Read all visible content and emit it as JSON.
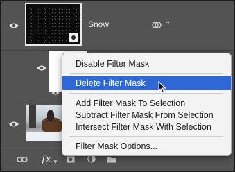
{
  "layers": {
    "snow": {
      "name": "Snow"
    }
  },
  "context_menu": {
    "items": [
      {
        "label": "Disable Filter Mask",
        "active": false
      },
      {
        "label": "Delete Filter Mask",
        "active": true
      },
      {
        "label": "Add Filter Mask To Selection",
        "active": false
      },
      {
        "label": "Subtract Filter Mask From Selection",
        "active": false
      },
      {
        "label": "Intersect Filter Mask With Selection",
        "active": false
      },
      {
        "label": "Filter Mask Options...",
        "active": false
      }
    ]
  },
  "toolbar": {
    "fx_label": "fx",
    "icons": [
      "link-icon",
      "fx-icon",
      "adjustment-icon",
      "group-icon",
      "new-layer-icon",
      "trash-icon"
    ]
  },
  "colors": {
    "panel_bg": "#535353",
    "menu_bg": "#f3f3f3",
    "menu_highlight": "#2f68d6"
  }
}
